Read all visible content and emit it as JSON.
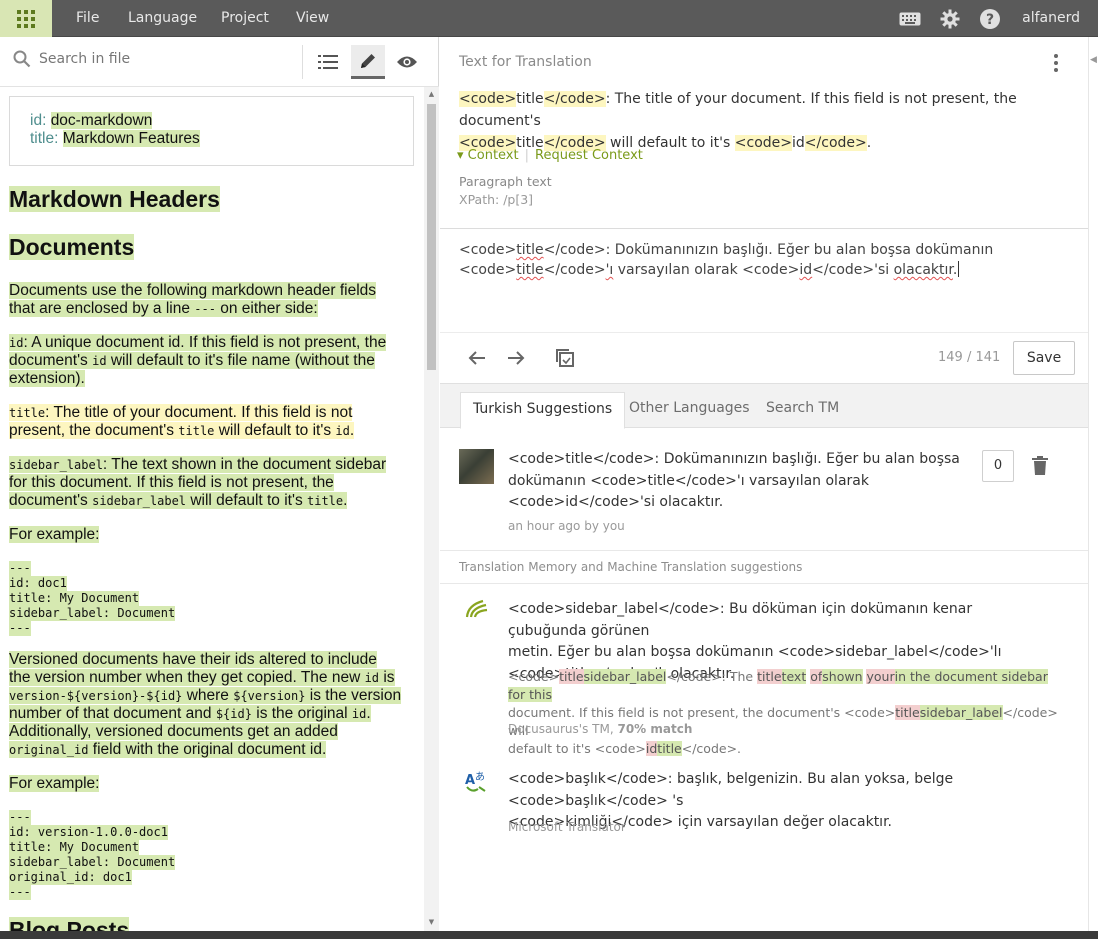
{
  "topbar": {
    "menu": [
      "File",
      "Language",
      "Project",
      "View"
    ],
    "username": "alfanerd",
    "icons": [
      "keyboard-icon",
      "gear-icon",
      "help-icon"
    ]
  },
  "left": {
    "search_placeholder": "Search in file",
    "meta": {
      "id_key": "id:",
      "id_val": "doc-markdown",
      "title_key": "title:",
      "title_val": "Markdown Features"
    },
    "h_markdown_headers": "Markdown Headers",
    "h_documents": "Documents",
    "p1": {
      "a": "Documents use the following markdown header fields",
      "b": "that are enclosed by a line ",
      "c": "---",
      "d": " on either side:"
    },
    "p_id": {
      "code1": "id",
      "a": ": A unique document id. If this field is not present, the",
      "b": "document's ",
      "code2": "id",
      "c": " will default to it's file name (without the",
      "d": "extension)."
    },
    "p_title": {
      "code1": "title",
      "a": ": The title of your document. If this field is not",
      "b": "present, the document's ",
      "code2": "title",
      "c": " will default to it's ",
      "code3": "id",
      "d": "."
    },
    "p_sidebar": {
      "code1": "sidebar_label",
      "a": ": The text shown in the document sidebar",
      "b": "for this document. If this field is not present, the",
      "c": "document's ",
      "code2": "sidebar_label",
      "d": " will default to it's ",
      "code3": "title",
      "e": "."
    },
    "for_example_1": "For example:",
    "code1": [
      "---",
      "id: doc1",
      "title: My Document",
      "sidebar_label: Document",
      "---"
    ],
    "p_versioned": {
      "l1": "Versioned documents have their ids altered to include",
      "l2a": "the version number when they get copied. The new ",
      "l2code": "id",
      "l2b": " is",
      "l3code1": "version-${version}-${id}",
      "l3a": " where ",
      "l3code2": "${version}",
      "l3b": " is the version",
      "l4a": "number of that document and ",
      "l4code": "${id}",
      "l4b": " is the original ",
      "l4code2": "id",
      "l4c": ".",
      "l5": "Additionally, versioned documents get an added",
      "l6code": "original_id",
      "l6a": " field with the original document id."
    },
    "for_example_2": "For example:",
    "code2": [
      "---",
      "id: version-1.0.0-doc1",
      "title: My Document",
      "sidebar_label: Document",
      "original_id: doc1",
      "---"
    ],
    "h_blog": "Blog Posts"
  },
  "right": {
    "source_head": "Text for Translation",
    "source": {
      "l1a": "<code>",
      "l1b": "title",
      "l1c": "</code>",
      "l1d": ": The title of your document. If this field is not present, the document's",
      "l2a": "<code>",
      "l2b": "title",
      "l2c": "</code>",
      "l2d": " will default to it's ",
      "l2e": "<code>",
      "l2f": "id",
      "l2g": "</code>",
      "l2h": "."
    },
    "context_label": "Context",
    "request_context": "Request Context",
    "para_type": "Paragraph text",
    "xpath": "XPath: /p[3]",
    "target": {
      "l1a": "<code>",
      "l1b": "title",
      "l1c": "</code>",
      "l1d": ": ",
      "l1e": "Dokümanınızın",
      "l1f": " ",
      "l1g": "başlığı",
      "l1h": ". Eğer bu alan ",
      "l1i": "boşsa",
      "l1j": " ",
      "l1k": "dokümanın",
      "l2a": "<code>",
      "l2b": "title",
      "l2c": "</code>",
      "l2d": "'ı",
      "l2e": " varsayılan olarak ",
      "l2f": "<code>",
      "l2g": "id",
      "l2h": "</code>",
      "l2i": "'si ",
      "l2j": "olacaktır",
      "l2k": "."
    },
    "char_count": "149 / 141",
    "save_label": "Save",
    "tabs": [
      "Turkish Suggestions",
      "Other Languages",
      "Search TM"
    ],
    "suggestion": {
      "l1": "<code>title</code>: Dokümanınızın başlığı. Eğer bu alan boşsa",
      "l2": "dokümanın <code>title</code>'ı varsayılan olarak",
      "l3": "<code>id</code>'si olacaktır.",
      "meta": "an hour ago by you",
      "votes": "0"
    },
    "tm_section": "Translation Memory and Machine Translation suggestions",
    "tm": {
      "l1": "<code>sidebar_label</code>: Bu döküman için dokümanın kenar çubuğunda görünen",
      "l2": "metin. Eğer bu alan boşsa dokümanın <code>sidebar_label</code>'lı",
      "l3": "<code>title</code>'lı olacaktır.",
      "diff": {
        "s1": "<code>",
        "s2_del": "title",
        "s3_add": "sidebar_label",
        "s4": "</code>: The ",
        "s5_del": "title",
        "s6_add": "text",
        "s7": " ",
        "s8_del": "of",
        "s9_add": "shown",
        "s10": " ",
        "s11_del": "your",
        "s12_add": "in the document sidebar for this",
        "s13": "document. If this field is not present, the document's <code>",
        "s14_del": "title",
        "s15_add": "sidebar_label",
        "s16": "</code> will",
        "s17": "default to it's <code>",
        "s18_del": "id",
        "s19_add": "title",
        "s20": "</code>."
      },
      "source": "Docusaurus's TM, ",
      "match": "70% match"
    },
    "mt": {
      "l1": "<code>başlık</code>: başlık, belgenizin. Bu alan yoksa, belge <code>başlık</code> 's",
      "l2": "<code>kimliği</code> için varsayılan değer olacaktır.",
      "source": "Microsoft Translator"
    }
  },
  "colors": {
    "accent_green": "#7a9a1a",
    "highlight_green": "#d6e9b1",
    "highlight_yellow": "#fdf6c0",
    "topbar": "#5a5a5a"
  }
}
